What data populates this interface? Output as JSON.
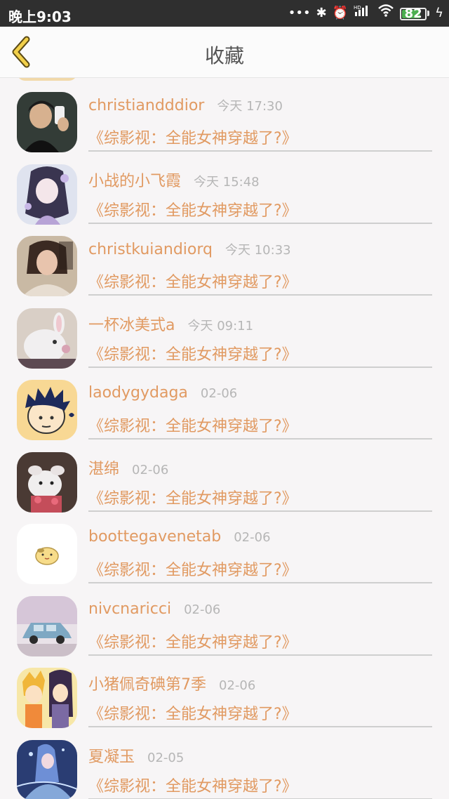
{
  "status": {
    "time": "晚上9:03",
    "battery": "82",
    "battery_level": 0.82
  },
  "header": {
    "title": "收藏"
  },
  "items": [
    {
      "username": "christiandddior",
      "time": "今天 17:30",
      "book": "《综影视：全能女神穿越了?》",
      "avatar": "avatar-man-selfie"
    },
    {
      "username": "小战的小飞霞",
      "time": "今天 15:48",
      "book": "《综影视：全能女神穿越了?》",
      "avatar": "avatar-anime-girl-purple"
    },
    {
      "username": "christkuiandiorq",
      "time": "今天 10:33",
      "book": "《综影视：全能女神穿越了?》",
      "avatar": "avatar-woman-photo"
    },
    {
      "username": "一杯冰美式a",
      "time": "今天 09:11",
      "book": "《综影视：全能女神穿越了?》",
      "avatar": "avatar-bunny-plush"
    },
    {
      "username": "laodygydaga",
      "time": "02-06",
      "book": "《综影视：全能女神穿越了?》",
      "avatar": "avatar-cartoon-boy"
    },
    {
      "username": "湛绵",
      "time": "02-06",
      "book": "《综影视：全能女神穿越了?》",
      "avatar": "avatar-white-rabbit"
    },
    {
      "username": "boottegavenetab",
      "time": "02-06",
      "book": "《综影视：全能女神穿越了?》",
      "avatar": "avatar-cartoon-chick"
    },
    {
      "username": "nivcnaricci",
      "time": "02-06",
      "book": "《综影视：全能女神穿越了?》",
      "avatar": "avatar-blue-car"
    },
    {
      "username": "小猪佩奇碘第7季",
      "time": "02-06",
      "book": "《综影视：全能女神穿越了?》",
      "avatar": "avatar-anime-couple"
    },
    {
      "username": "夏凝玉",
      "time": "02-05",
      "book": "《综影视：全能女神穿越了?》",
      "avatar": "avatar-fantasy-art"
    }
  ]
}
